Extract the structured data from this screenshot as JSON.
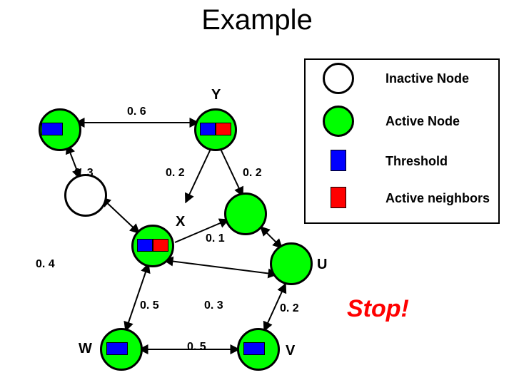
{
  "title": "Example",
  "legend": {
    "inactive": "Inactive Node",
    "active": "Active Node",
    "threshold": "Threshold",
    "active_neighbors": "Active neighbors"
  },
  "nodes": {
    "Y": "Y",
    "X": "X",
    "W": "W",
    "U": "U",
    "V": "V"
  },
  "edge_weights": {
    "w06": "0. 6",
    "w02_left": "0. 2",
    "w02_mid": "0. 2",
    "w01": "0. 1",
    "w04": "0. 4",
    "w05": "0. 5",
    "w03_near_u": "0. 3",
    "w02_uv": "0. 2",
    "w05_wv": "0. 5",
    "w03_left": "0. 3"
  },
  "stop": "Stop!",
  "colors": {
    "blue": "#0000ff",
    "red": "#ff0000",
    "green": "#00ff00"
  }
}
